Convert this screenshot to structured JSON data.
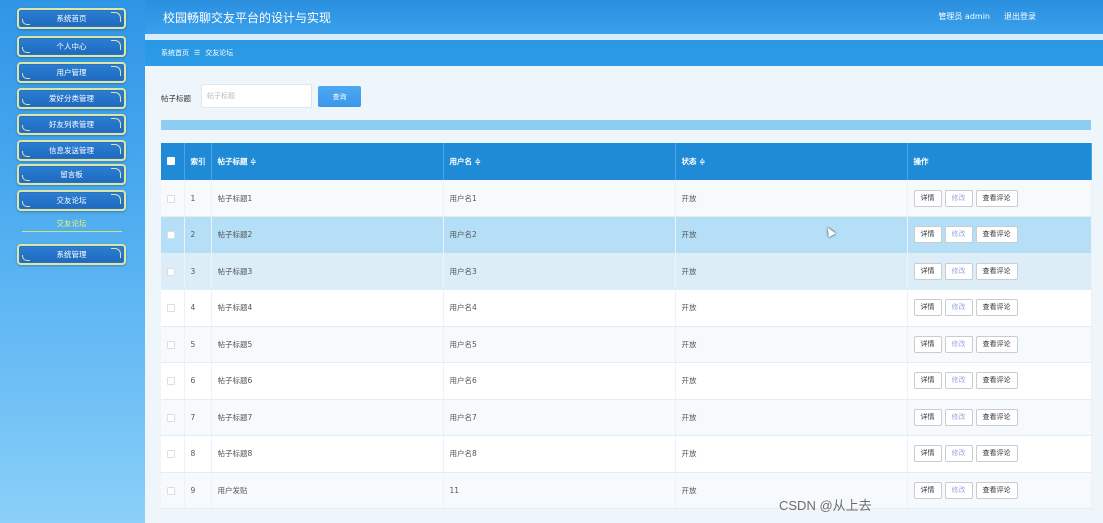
{
  "app": {
    "title": "校园畅聊交友平台的设计与实现",
    "admin_label": "管理员 admin",
    "logout_label": "退出登录"
  },
  "sidebar": {
    "items": [
      {
        "label": "系统首页"
      },
      {
        "label": "个人中心"
      },
      {
        "label": "用户管理"
      },
      {
        "label": "爱好分类管理"
      },
      {
        "label": "好友列表管理"
      },
      {
        "label": "信息发送管理"
      },
      {
        "label": "留言板"
      },
      {
        "label": "交友论坛"
      },
      {
        "label": "系统管理"
      }
    ],
    "active_sub": "交友论坛"
  },
  "breadcrumb": {
    "home": "系统首页",
    "separator": "☰",
    "current": "交友论坛"
  },
  "search": {
    "label": "帖子标题",
    "placeholder": "帖子标题",
    "button": "查询"
  },
  "table": {
    "headers": {
      "index": "索引",
      "title": "帖子标题 ≑",
      "username": "用户名 ≑",
      "status": "状态 ≑",
      "actions": "操作"
    },
    "actions": {
      "detail": "详情",
      "edit": "修改",
      "comments": "查看评论"
    },
    "rows": [
      {
        "index": "1",
        "title": "帖子标题1",
        "username": "用户名1",
        "status": "开放"
      },
      {
        "index": "2",
        "title": "帖子标题2",
        "username": "用户名2",
        "status": "开放"
      },
      {
        "index": "3",
        "title": "帖子标题3",
        "username": "用户名3",
        "status": "开放"
      },
      {
        "index": "4",
        "title": "帖子标题4",
        "username": "用户名4",
        "status": "开放"
      },
      {
        "index": "5",
        "title": "帖子标题5",
        "username": "用户名5",
        "status": "开放"
      },
      {
        "index": "6",
        "title": "帖子标题6",
        "username": "用户名6",
        "status": "开放"
      },
      {
        "index": "7",
        "title": "帖子标题7",
        "username": "用户名7",
        "status": "开放"
      },
      {
        "index": "8",
        "title": "帖子标题8",
        "username": "用户名8",
        "status": "开放"
      },
      {
        "index": "9",
        "title": "用户发贴",
        "username": "11",
        "status": "开放"
      }
    ]
  },
  "watermark": "CSDN @从上去"
}
